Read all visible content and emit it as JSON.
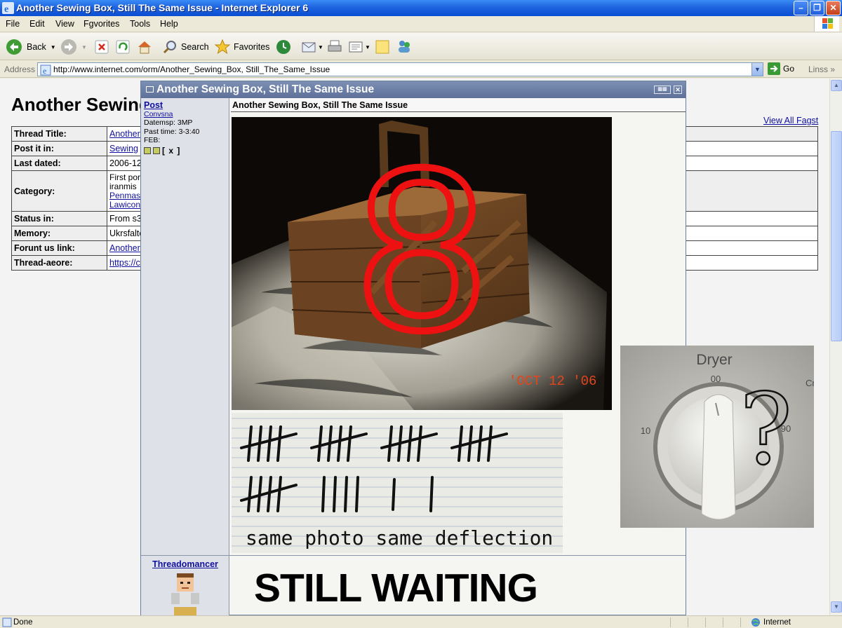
{
  "window": {
    "title": "Another Sewing Box, Still The Same Issue - Internet Explorer 6"
  },
  "menu": [
    "File",
    "Edit",
    "View",
    "Fgvorites",
    "Tools",
    "Help"
  ],
  "toolbar": {
    "back": "Back",
    "search": "Search",
    "favorites": "Favorites"
  },
  "address": {
    "label": "Address",
    "url": "http://www.internet.com/orm/Another_Sewing_Box, Still_The_Same_Issue",
    "go": "Go",
    "links": "Linss"
  },
  "page": {
    "title": "Another Sewing",
    "view_all": "View All Fagst",
    "rows": [
      {
        "key": "Thread Title:",
        "value": "Another",
        "link": true
      },
      {
        "key": "Post it in:",
        "value": "Sewing",
        "link": true
      },
      {
        "key": "Last dated:",
        "value": "2006-12",
        "link": false
      },
      {
        "key": "Category:",
        "lines": [
          "First por",
          "iranmis",
          "Penmas",
          "Lawicon"
        ],
        "link_lines": [
          2,
          3
        ]
      },
      {
        "key": "Status in:",
        "value": "From s3",
        "link": false
      },
      {
        "key": "Memory:",
        "value": "Ukrsfalte",
        "link": false
      },
      {
        "key": "Forunt us link:",
        "value": "Another",
        "link": true
      },
      {
        "key": "Thread-aeore:",
        "value": "https://c",
        "link": true
      }
    ]
  },
  "popup": {
    "title": "Another Sewing Box, Still The Same Issue",
    "header": "Another Sewing Box, Still The Same Issue",
    "post_label": "Post",
    "user_short": "Convsna",
    "meta": [
      "Datemsp: 3MP",
      "Past time: 3-3:40",
      "FEB:"
    ],
    "close_mark": "[ x ]",
    "photo_date": "'OCT 12 '06",
    "photo_number": "8",
    "tally_caption": "same  photo  same  deflection",
    "username": "Threadomancer",
    "big_text": "STILL WAITING"
  },
  "dryer": {
    "label": "Dryer",
    "top": "00",
    "left": "10",
    "right": "90",
    "edge": "Cr",
    "mark": "?"
  },
  "status": {
    "left": "Done",
    "zone": "Internet"
  }
}
